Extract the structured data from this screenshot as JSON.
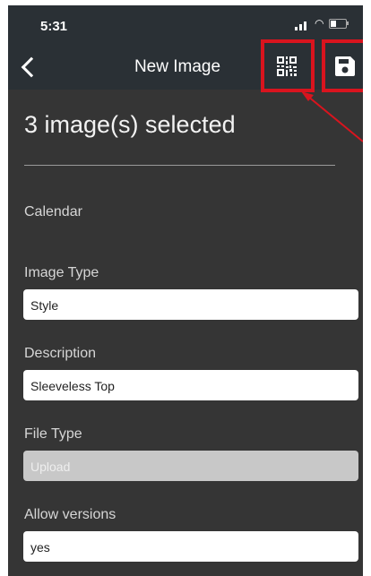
{
  "status": {
    "time": "5:31"
  },
  "nav": {
    "title": "New Image"
  },
  "header": {
    "selected_text": "3 image(s) selected"
  },
  "form": {
    "calendar_label": "Calendar",
    "image_type_label": "Image Type",
    "image_type_value": "Style",
    "description_label": "Description",
    "description_value": "Sleeveless Top",
    "file_type_label": "File Type",
    "file_type_value": "Upload",
    "allow_versions_label": "Allow versions",
    "allow_versions_value": "yes"
  },
  "colors": {
    "bar_bg": "#2a3035",
    "body_bg": "#353535",
    "highlight": "#d9141e"
  },
  "icons": [
    "back-chevron-icon",
    "qr-code-icon",
    "save-icon",
    "signal-icon",
    "wifi-icon",
    "battery-icon"
  ]
}
